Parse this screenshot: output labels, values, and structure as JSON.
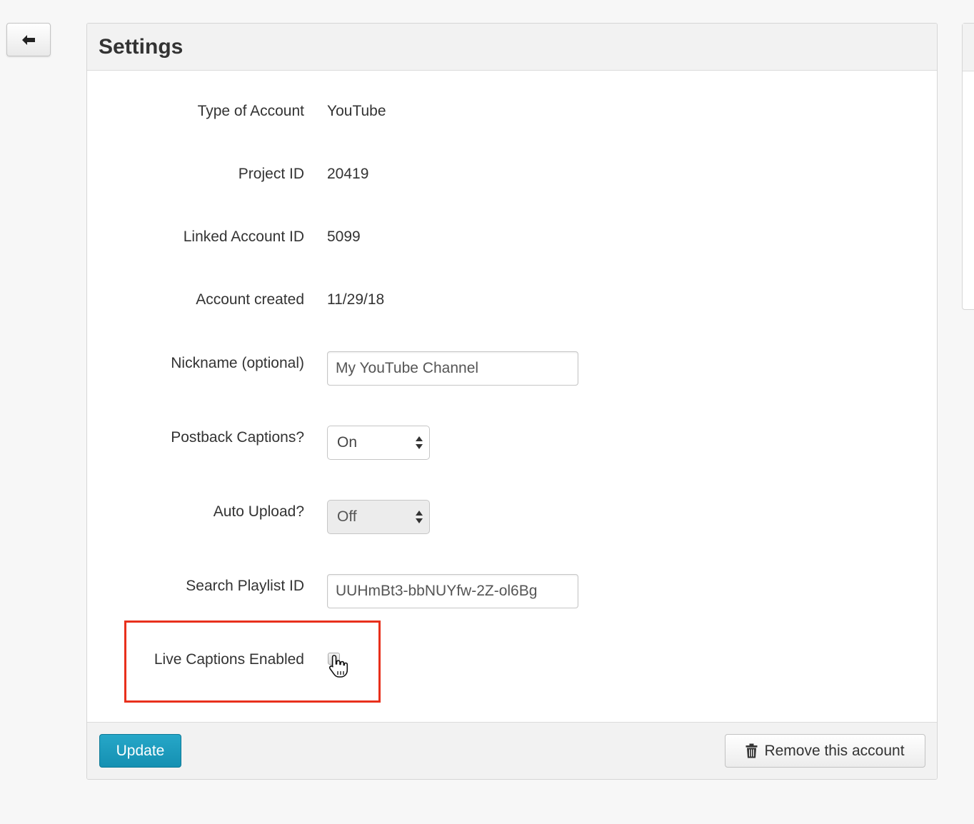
{
  "back_button": {
    "icon": "arrow-left-icon"
  },
  "panel": {
    "title": "Settings",
    "rows": [
      {
        "label": "Type of Account",
        "value": "YouTube"
      },
      {
        "label": "Project ID",
        "value": "20419"
      },
      {
        "label": "Linked Account ID",
        "value": "5099"
      },
      {
        "label": "Account created",
        "value": "11/29/18"
      }
    ],
    "nickname": {
      "label": "Nickname (optional)",
      "value": "My YouTube Channel"
    },
    "postback": {
      "label": "Postback Captions?",
      "selected": "On"
    },
    "auto_upload": {
      "label": "Auto Upload?",
      "selected": "Off"
    },
    "search_playlist": {
      "label": "Search Playlist ID",
      "value": "UUHmBt3-bbNUYfw-2Z-ol6Bg"
    },
    "live_captions": {
      "label": "Live Captions Enabled",
      "checked": false
    }
  },
  "footer": {
    "update_label": "Update",
    "remove_label": "Remove this account",
    "remove_icon": "trash-icon"
  },
  "colors": {
    "primary_button": "#1a9bbd",
    "highlight": "#e8301c",
    "panel_header": "#f2f2f2"
  }
}
